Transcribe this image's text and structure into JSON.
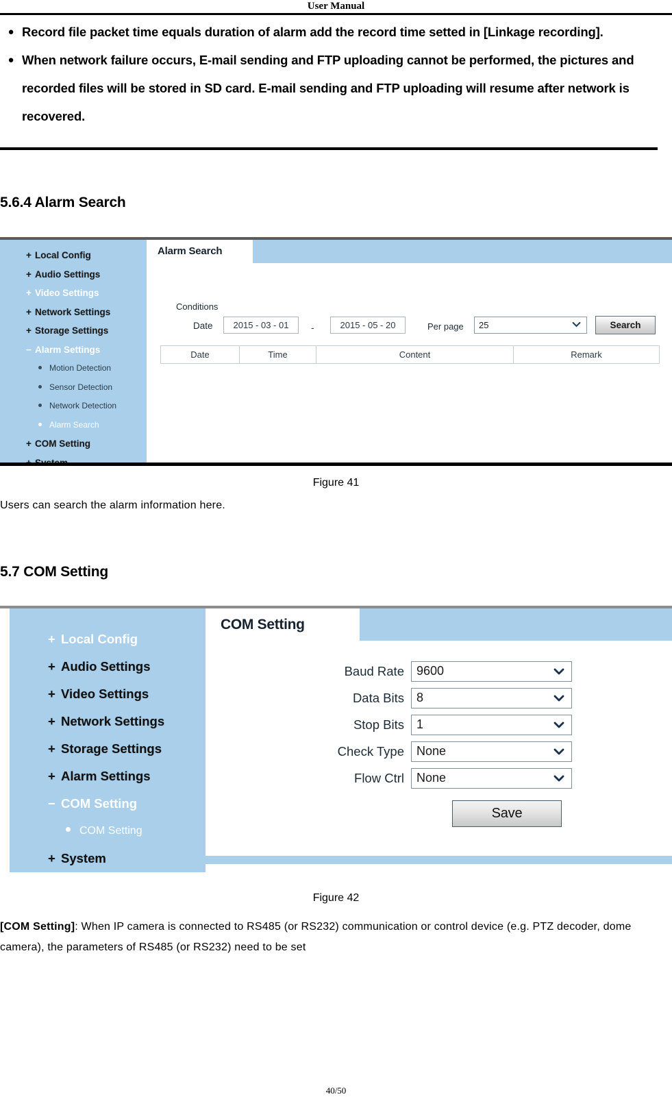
{
  "header": {
    "title": "User Manual"
  },
  "bullets": [
    "Record file packet time equals duration of alarm add the record time setted in [Linkage recording].",
    "When network failure occurs, E-mail sending and FTP uploading cannot be performed, the pictures and recorded files will be stored in SD card. E-mail sending and FTP uploading will resume after network is recovered."
  ],
  "section_alarm_search": {
    "heading": "5.6.4 Alarm Search"
  },
  "figure41": {
    "caption": "Figure 41",
    "description": "Users can search the alarm information here.",
    "tab_label": "Alarm Search",
    "sidebar": [
      {
        "label": "Local Config",
        "sign": "+",
        "level": "top",
        "state": "normal"
      },
      {
        "label": "Audio Settings",
        "sign": "+",
        "level": "top",
        "state": "normal"
      },
      {
        "label": "Video Settings",
        "sign": "+",
        "level": "top",
        "state": "dim"
      },
      {
        "label": "Network Settings",
        "sign": "+",
        "level": "top",
        "state": "normal"
      },
      {
        "label": "Storage Settings",
        "sign": "+",
        "level": "top",
        "state": "normal"
      },
      {
        "label": "Alarm Settings",
        "sign": "−",
        "level": "top",
        "state": "dim"
      },
      {
        "label": "Motion Detection",
        "sign": "",
        "level": "sub",
        "state": "normal"
      },
      {
        "label": "Sensor Detection",
        "sign": "",
        "level": "sub",
        "state": "normal"
      },
      {
        "label": "Network Detection",
        "sign": "",
        "level": "sub",
        "state": "normal"
      },
      {
        "label": "Alarm Search",
        "sign": "",
        "level": "sub",
        "state": "dim"
      },
      {
        "label": "COM Setting",
        "sign": "+",
        "level": "top",
        "state": "normal"
      },
      {
        "label": "System",
        "sign": "+",
        "level": "top",
        "state": "normal"
      }
    ],
    "conditions_label": "Conditions",
    "date_label": "Date",
    "date_from": "2015 - 03 - 01",
    "date_separator": "-",
    "date_to": "2015 - 05 - 20",
    "per_page_label": "Per page",
    "per_page_value": "25",
    "search_button": "Search",
    "table_headers": [
      "Date",
      "Time",
      "Content",
      "Remark"
    ]
  },
  "section_com_setting": {
    "heading": "5.7 COM Setting"
  },
  "figure42": {
    "caption": "Figure 42",
    "tab_label": "COM Setting",
    "sidebar": [
      {
        "label": "Local Config",
        "sign": "+",
        "level": "top",
        "state": "dim"
      },
      {
        "label": "Audio Settings",
        "sign": "+",
        "level": "top",
        "state": "normal"
      },
      {
        "label": "Video Settings",
        "sign": "+",
        "level": "top",
        "state": "normal"
      },
      {
        "label": "Network Settings",
        "sign": "+",
        "level": "top",
        "state": "normal"
      },
      {
        "label": "Storage Settings",
        "sign": "+",
        "level": "top",
        "state": "normal"
      },
      {
        "label": "Alarm Settings",
        "sign": "+",
        "level": "top",
        "state": "normal"
      },
      {
        "label": "COM Setting",
        "sign": "−",
        "level": "top",
        "state": "dim"
      },
      {
        "label": "COM Setting",
        "sign": "",
        "level": "sub",
        "state": "dim"
      },
      {
        "label": "System",
        "sign": "+",
        "level": "top",
        "state": "normal"
      }
    ],
    "fields": [
      {
        "label": "Baud Rate",
        "value": "9600"
      },
      {
        "label": "Data Bits",
        "value": "8"
      },
      {
        "label": "Stop Bits",
        "value": "1"
      },
      {
        "label": "Check Type",
        "value": "None"
      },
      {
        "label": "Flow Ctrl",
        "value": "None"
      }
    ],
    "save_button": "Save"
  },
  "footer_paragraph": {
    "bold_prefix": "[COM Setting]",
    "rest": ": When IP camera is connected to RS485 (or RS232) communication or control device (e.g. PTZ decoder, dome camera), the parameters of RS485 (or RS232) need to be set"
  },
  "page_number": "40/50"
}
